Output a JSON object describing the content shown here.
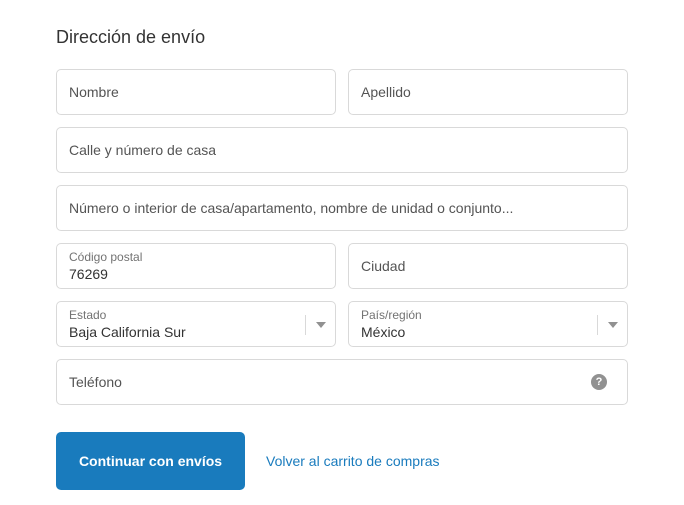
{
  "section": {
    "title": "Dirección de envío"
  },
  "form": {
    "first_name": {
      "placeholder": "Nombre"
    },
    "last_name": {
      "placeholder": "Apellido"
    },
    "street": {
      "placeholder": "Calle y número de casa"
    },
    "apartment": {
      "placeholder": "Número o interior de casa/apartamento, nombre de unidad o conjunto..."
    },
    "postal_code": {
      "label": "Código postal",
      "value": "76269"
    },
    "city": {
      "placeholder": "Ciudad"
    },
    "state": {
      "label": "Estado",
      "value": "Baja California Sur"
    },
    "country": {
      "label": "País/región",
      "value": "México"
    },
    "phone": {
      "placeholder": "Teléfono",
      "help_icon": "question-mark-icon",
      "help_glyph": "?"
    }
  },
  "actions": {
    "continue_label": "Continuar con envíos",
    "back_link_label": "Volver al carrito de compras"
  },
  "colors": {
    "accent": "#197bbd",
    "border": "#d9d9d9",
    "text": "#333333",
    "placeholder": "#545454"
  }
}
